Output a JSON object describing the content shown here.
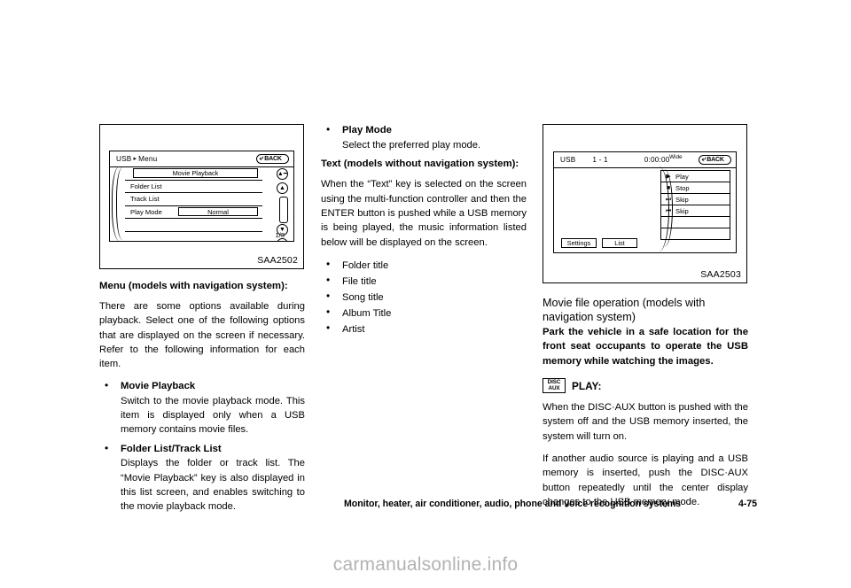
{
  "figure1": {
    "caption": "SAA2502",
    "screen": {
      "header_title": "USB",
      "header_sep": "▸",
      "header_subtitle": "Menu",
      "back_label": "BACK",
      "back_icon": "back-arrow-icon",
      "rows": [
        {
          "key": "Movie Playback",
          "type": "wide-key"
        },
        {
          "label": "Folder List",
          "type": "label"
        },
        {
          "label": "Track List",
          "type": "label"
        },
        {
          "label": "Play Mode",
          "value": "Normal",
          "type": "label-value"
        },
        {
          "label": "",
          "type": "blank"
        },
        {
          "label": "",
          "type": "blank"
        }
      ],
      "page_indicator": "1/3",
      "scroll_buttons": [
        {
          "name": "scroll-top-icon",
          "glyph": "⮕"
        },
        {
          "name": "scroll-up-icon",
          "glyph": "▲"
        },
        {
          "name": "scroll-thumb",
          "glyph": ""
        },
        {
          "name": "scroll-down-icon",
          "glyph": "▼"
        },
        {
          "name": "scroll-bottom-icon",
          "glyph": "⮕"
        }
      ]
    }
  },
  "figure2": {
    "caption": "SAA2503",
    "screen": {
      "source": "USB",
      "track": "1 - 1",
      "time": "0:00:00",
      "aspect": "Wide",
      "back_label": "BACK",
      "buttons": [
        {
          "icon": "play-icon",
          "glyph": "▶",
          "label": "Play"
        },
        {
          "icon": "stop-icon",
          "glyph": "■",
          "label": "Stop"
        },
        {
          "icon": "skip-forward-icon",
          "glyph": "⏭",
          "label": "Skip"
        },
        {
          "icon": "skip-back-icon",
          "glyph": "⏮",
          "label": "Skip"
        },
        {
          "icon": "",
          "glyph": "",
          "label": ""
        },
        {
          "icon": "",
          "glyph": "",
          "label": ""
        }
      ],
      "bottom_buttons": [
        "Settings",
        "List"
      ]
    }
  },
  "column1": {
    "heading": "Menu (models with navigation system):",
    "intro": "There are some options available during playback. Select one of the following options that are displayed on the screen if necessary. Refer to the following information for each item.",
    "items": [
      {
        "title": "Movie Playback",
        "body": "Switch to the movie playback mode. This item is displayed only when a USB memory contains movie files."
      },
      {
        "title": "Folder List/Track List",
        "body": "Displays the folder or track list. The “Movie Playback” key is also displayed in this list screen, and enables switching to the movie playback mode."
      }
    ]
  },
  "column2": {
    "item": {
      "title": "Play Mode",
      "body": "Select the preferred play mode."
    },
    "heading": "Text (models without navigation system):",
    "intro": "When the “Text” key is selected on the screen using the multi-function controller and then the ENTER button is pushed while a USB memory is being played, the music information listed below will be displayed on the screen.",
    "list": [
      "Folder title",
      "File title",
      "Song title",
      "Album Title",
      "Artist"
    ]
  },
  "column3": {
    "heading": "Movie file operation (models with navigation system)",
    "warning": "Park the vehicle in a safe location for the front seat occupants to operate the USB memory while watching the images.",
    "disc_button": {
      "line1": "DISC",
      "line2": "AUX"
    },
    "play_label": "PLAY:",
    "paragraph1": "When the DISC·AUX button is pushed with the system off and the USB memory inserted, the system will turn on.",
    "paragraph2": "If another audio source is playing and a USB memory is inserted, push the DISC·AUX button repeatedly until the center display changes to the USB memory mode."
  },
  "footer": {
    "chapter": "Monitor, heater, air conditioner, audio, phone and voice recognition systems",
    "page": "4-75"
  },
  "watermark": "carmanualsonline.info"
}
